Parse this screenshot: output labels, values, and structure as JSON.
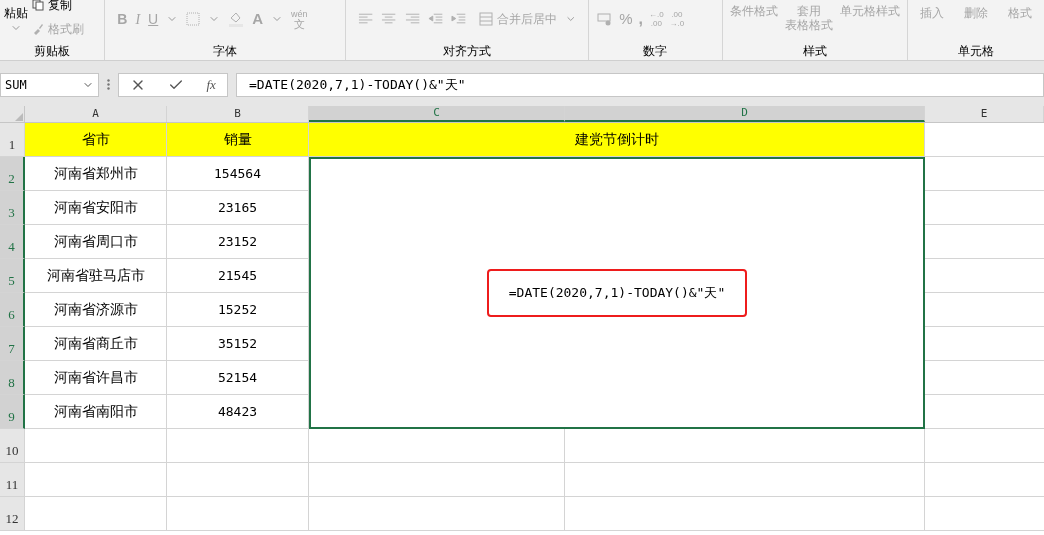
{
  "ribbon": {
    "disabled": true,
    "clipboard": {
      "label": "剪贴板",
      "paste": "粘贴",
      "copy": "复制",
      "painter": "格式刷"
    },
    "font": {
      "label": "字体",
      "bold": "B",
      "italic": "I",
      "underline": "U",
      "font_color": "A",
      "phonetic_top": "wén",
      "phonetic_bottom": "文"
    },
    "alignment": {
      "label": "对齐方式",
      "merge": "合并后居中"
    },
    "number": {
      "label": "数字",
      "percent": "%",
      "comma": ",",
      "increase_decimal": [
        "←.0",
        ".00"
      ],
      "decrease_decimal": [
        ".00",
        "→.0"
      ]
    },
    "styles": {
      "label": "样式",
      "buttons": [
        {
          "lines": [
            "条件格式"
          ]
        },
        {
          "lines": [
            "套用",
            "表格格式"
          ]
        },
        {
          "lines": [
            "单元格样式"
          ]
        }
      ]
    },
    "cells": {
      "label": "单元格",
      "buttons": [
        "插入",
        "删除",
        "格式"
      ]
    }
  },
  "formula_bar": {
    "name_box": "SUM",
    "fx": "fx",
    "formula": "=DATE(2020,7,1)-TODAY()&\"天\""
  },
  "sheet": {
    "columns": [
      {
        "label": "A",
        "selected": false
      },
      {
        "label": "B",
        "selected": false
      },
      {
        "label": "C",
        "selected": true
      },
      {
        "label": "D",
        "selected": true
      },
      {
        "label": "E",
        "selected": false
      }
    ],
    "rows": [
      {
        "label": "1",
        "selected": false
      },
      {
        "label": "2",
        "selected": true
      },
      {
        "label": "3",
        "selected": true
      },
      {
        "label": "4",
        "selected": true
      },
      {
        "label": "5",
        "selected": true
      },
      {
        "label": "6",
        "selected": true
      },
      {
        "label": "7",
        "selected": true
      },
      {
        "label": "8",
        "selected": true
      },
      {
        "label": "9",
        "selected": true
      },
      {
        "label": "10",
        "selected": false
      },
      {
        "label": "11",
        "selected": false
      },
      {
        "label": "12",
        "selected": false
      }
    ],
    "header": {
      "province": "省市",
      "sales": "销量",
      "title": "建党节倒计时"
    },
    "data": [
      {
        "province": "河南省郑州市",
        "sales": "154564"
      },
      {
        "province": "河南省安阳市",
        "sales": "23165"
      },
      {
        "province": "河南省周口市",
        "sales": "23152"
      },
      {
        "province": "河南省驻马店市",
        "sales": "21545"
      },
      {
        "province": "河南省济源市",
        "sales": "15252"
      },
      {
        "province": "河南省商丘市",
        "sales": "35152"
      },
      {
        "province": "河南省许昌市",
        "sales": "52154"
      },
      {
        "province": "河南省南阳市",
        "sales": "48423"
      }
    ],
    "merged_cell": {
      "text": "=DATE(2020,7,1)-TODAY()&\"天\"",
      "highlighted": true
    }
  }
}
